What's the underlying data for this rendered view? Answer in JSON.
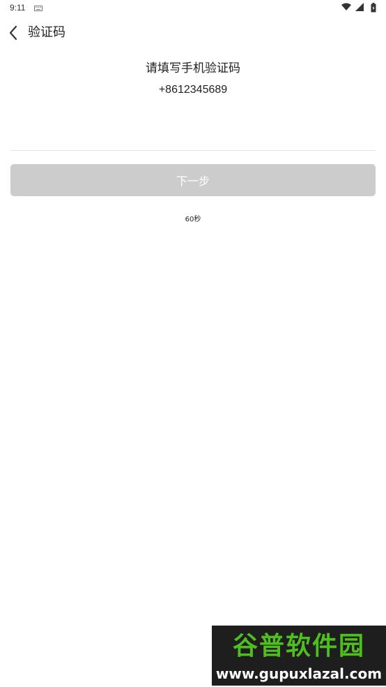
{
  "status_bar": {
    "time": "9:11",
    "icons": [
      "keyboard-icon",
      "wifi-icon",
      "signal-icon",
      "battery-icon"
    ]
  },
  "app_bar": {
    "back_icon": "chevron-left-icon",
    "title": "验证码"
  },
  "main": {
    "prompt": "请填写手机验证码",
    "phone": "+8612345689",
    "code_input": {
      "value": "",
      "placeholder": ""
    },
    "next_button_label": "下一步",
    "countdown": "60秒"
  },
  "watermark": {
    "title": "谷普软件园",
    "url": "www.gupuxlazal.com"
  },
  "colors": {
    "background": "#ffffff",
    "text": "#222222",
    "button_disabled": "#cccccc",
    "button_text": "#ffffff",
    "divider": "#e2e2e2",
    "watermark_green": "#4fbf1f"
  }
}
